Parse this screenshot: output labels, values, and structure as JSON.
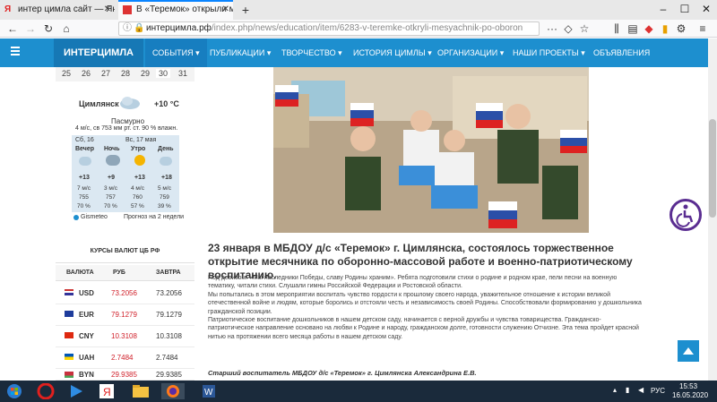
{
  "browser": {
    "tabs": [
      {
        "label": "интер цимла сайт — Яндекс:",
        "active": false
      },
      {
        "label": "В «Теремок» открыли месячни",
        "active": true
      }
    ],
    "url_host": "интерцимла.рф",
    "url_path": "/index.php/news/education/item/6283-v-teremke-otkryli-mesyachnik-po-oboron"
  },
  "site": {
    "brand": "ИНТЕРЦИМЛА",
    "menu": [
      "СОБЫТИЯ",
      "ПУБЛИКАЦИИ",
      "ТВОРЧЕСТВО",
      "ИСТОРИЯ ЦИМЛЫ",
      "ОРГАНИЗАЦИИ",
      "НАШИ ПРОЕКТЫ",
      "ОБЪЯВЛЕНИЯ"
    ]
  },
  "calendar": {
    "days": [
      "25",
      "26",
      "27",
      "28",
      "29",
      "30",
      "31"
    ]
  },
  "weather": {
    "city": "Цимлянск",
    "temp": "+10 °C",
    "condition": "Пасмурно",
    "details": "4 м/с, св   753 мм рт. ст.   90 % влажн.",
    "day1": "Сб, 16",
    "day2": "Вс, 17 мая",
    "periods": [
      {
        "name": "Вечер",
        "temp": "+13",
        "wind": "7 м/с",
        "pressure": "755",
        "humidity": "70 %"
      },
      {
        "name": "Ночь",
        "temp": "+9",
        "wind": "3 м/с",
        "pressure": "757",
        "humidity": "70 %"
      },
      {
        "name": "Утро",
        "temp": "+13",
        "wind": "4 м/с",
        "pressure": "760",
        "humidity": "57 %"
      },
      {
        "name": "День",
        "temp": "+18",
        "wind": "5 м/с",
        "pressure": "759",
        "humidity": "39 %"
      }
    ],
    "provider": "Gismeteo",
    "forecast_link": "Прогноз на 2 недели"
  },
  "currency": {
    "title": "КУРСЫ ВАЛЮТ ЦБ РФ",
    "headers": [
      "ВАЛЮТА",
      "РУБ",
      "ЗАВТРА"
    ],
    "rows": [
      {
        "code": "USD",
        "today": "73.2056",
        "tomorrow": "73.2056"
      },
      {
        "code": "EUR",
        "today": "79.1279",
        "tomorrow": "79.1279"
      },
      {
        "code": "CNY",
        "today": "10.3108",
        "tomorrow": "10.3108"
      },
      {
        "code": "UAH",
        "today": "2.7484",
        "tomorrow": "2.7484"
      },
      {
        "code": "BYN",
        "today": "29.9385",
        "tomorrow": "29.9385"
      }
    ]
  },
  "article": {
    "headline": "23 января в МБДОУ д/с «Теремок» г. Цимлянска, состоялось торжественное открытие месячника по оборонно-массовой работе и военно-патриотическому воспитанию.",
    "p1": "Под девизом: «Мы наследники Победы, славу Родины храним». Ребята подготовили стихи о родине и родном крае, пели песни на военную тематику, читали стихи. Слушали гимны Российской Федерации и Ростовской области.",
    "p2": "Мы попытались в этом мероприятии воспитать чувство гордости к прошлому своего народа, уважительное отношение к истории великой отечественной войне и людям, которые боролись и отстояли честь и независимость своей Родины. Способствовали формированию у дошкольника гражданской позиции.",
    "p3": "Патриотическое воспитание дошкольников в нашем детском саду, начинается с верной дружбы и чувства товарищества. Гражданско-патриотическое направление основано на любви к Родине и народу, гражданском долге, готовности служению Отчизне. Эта тема пройдет красной нитью на протяжении всего месяца работы в нашем детском саду.",
    "signature": "Старший воспитатель МБДОУ д/с «Теремок» г. Цимлянска Александрина Е.В."
  },
  "taskbar": {
    "lang": "РУС",
    "time": "15:53",
    "date": "16.05.2020"
  },
  "colors": {
    "header_blue": "#1d8fcf",
    "brand_blue": "#1678b5",
    "currency_red": "#d0202a",
    "a11y_purple": "#5a2d91"
  }
}
